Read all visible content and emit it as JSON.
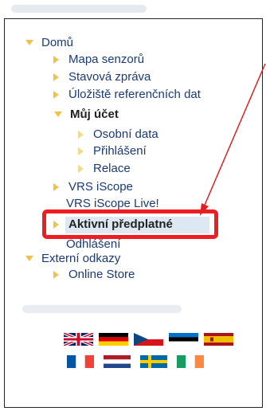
{
  "menu": {
    "home": "Domů",
    "home_items": [
      "Mapa senzorů",
      "Stavová zpráva",
      "Úložiště referenčních dat"
    ],
    "my_account": "Můj účet",
    "my_account_items": [
      "Osobní data",
      "Přihlášení",
      "Relace"
    ],
    "vrs_iscope": "VRS iScope",
    "vrs_iscope_live": "VRS iScope Live!",
    "active_subscription": "Aktivní předplatné",
    "logout": "Odhlášení",
    "external": "Externí odkazy",
    "external_items": [
      "Online Store"
    ]
  },
  "languages": [
    {
      "name": "english-flag-icon"
    },
    {
      "name": "german-flag-icon"
    },
    {
      "name": "czech-flag-icon"
    },
    {
      "name": "estonian-flag-icon"
    },
    {
      "name": "spanish-flag-icon"
    },
    {
      "name": "french-flag-icon"
    },
    {
      "name": "dutch-flag-icon"
    },
    {
      "name": "swedish-flag-icon"
    },
    {
      "name": "irish-flag-icon"
    }
  ],
  "colors": {
    "accent_arrow": "#f0c24a",
    "link": "#1a3a7a",
    "highlight": "#ee1c25"
  }
}
